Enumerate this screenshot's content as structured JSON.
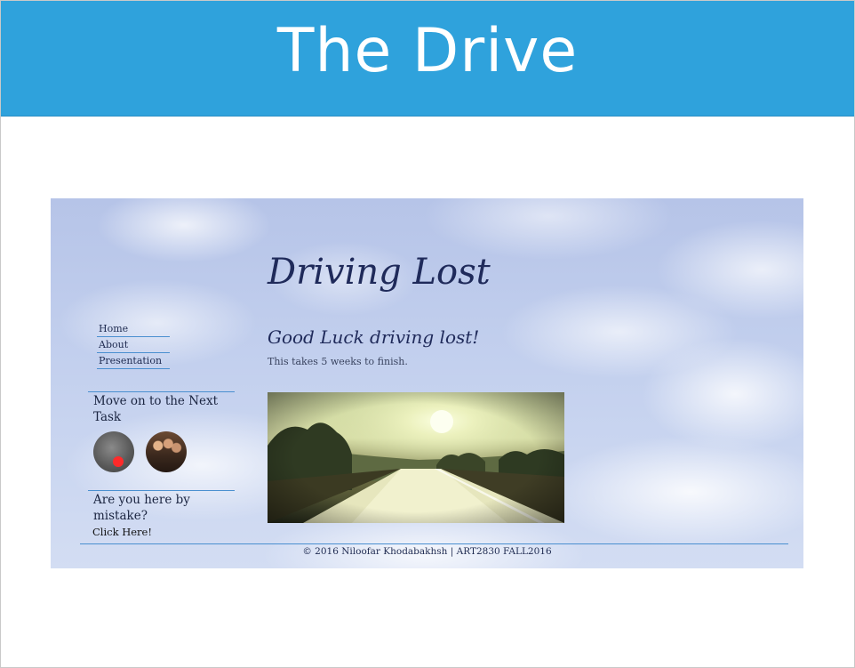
{
  "slide": {
    "title": "The Drive"
  },
  "website": {
    "site_title": "Driving Lost",
    "nav": {
      "items": [
        {
          "label": "Home"
        },
        {
          "label": "About"
        },
        {
          "label": "Presentation"
        }
      ]
    },
    "sidebar": {
      "next_task_heading": "Move on to the Next Task",
      "mistake_heading": "Are you here by mistake?",
      "click_here_label": "Click Here!"
    },
    "post": {
      "title": "Good Luck driving lost!",
      "body": "This takes 5 weeks to finish."
    },
    "footer": {
      "text": "© 2016 Niloofar Khodabakhsh | ART2830 FALL2016"
    },
    "icons": {
      "thumb_a_indicator": "red-dot",
      "thumb_a_indicator_color": "#ff2a2a"
    }
  },
  "colors": {
    "banner": "#2fa2dc",
    "title_text": "#1f2a5a",
    "rule": "#4a8fd0"
  }
}
